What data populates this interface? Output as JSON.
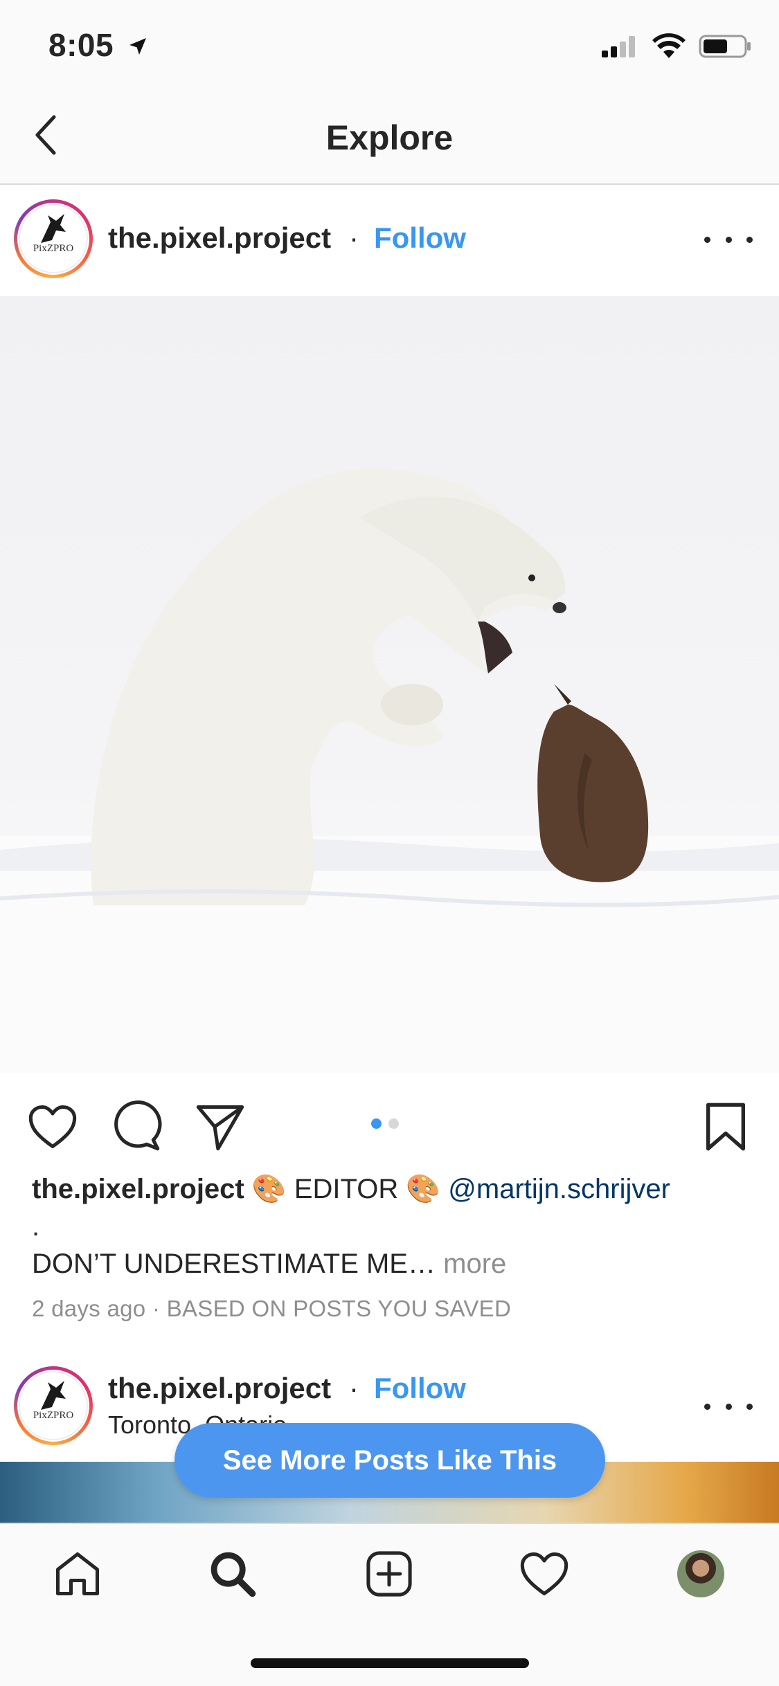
{
  "status_bar": {
    "time": "8:05"
  },
  "nav": {
    "title": "Explore",
    "back_icon": "chevron-left-icon"
  },
  "post": {
    "username": "the.pixel.project",
    "separator": "·",
    "follow_label": "Follow",
    "avatar_logo_text": "PixZPRO",
    "photo_alt": "polar-bear-and-penguin-photo",
    "carousel": {
      "total": 2,
      "current": 1
    },
    "caption": {
      "username": "the.pixel.project",
      "emoji_palette": "🎨",
      "editor_text": "EDITOR",
      "mention": "@martijn.schrijver",
      "dot_line": ".",
      "body": "DON’T UNDERESTIMATE ME…",
      "more_label": "more"
    },
    "meta": "2 days ago · BASED ON POSTS YOU SAVED"
  },
  "next_post": {
    "username": "the.pixel.project",
    "separator": "·",
    "follow_label": "Follow",
    "location": "Toronto, Ontario",
    "avatar_logo_text": "PixZPRO"
  },
  "cta": {
    "label": "See More Posts Like This"
  },
  "colors": {
    "link_blue": "#3897f0",
    "cta_blue": "#4d96f0",
    "mention_blue": "#003569",
    "muted": "#8e8e8e"
  },
  "tab_bar": {
    "items": [
      {
        "icon": "home-icon"
      },
      {
        "icon": "search-icon",
        "active": true
      },
      {
        "icon": "add-post-icon"
      },
      {
        "icon": "heart-icon"
      },
      {
        "icon": "profile-avatar"
      }
    ]
  }
}
